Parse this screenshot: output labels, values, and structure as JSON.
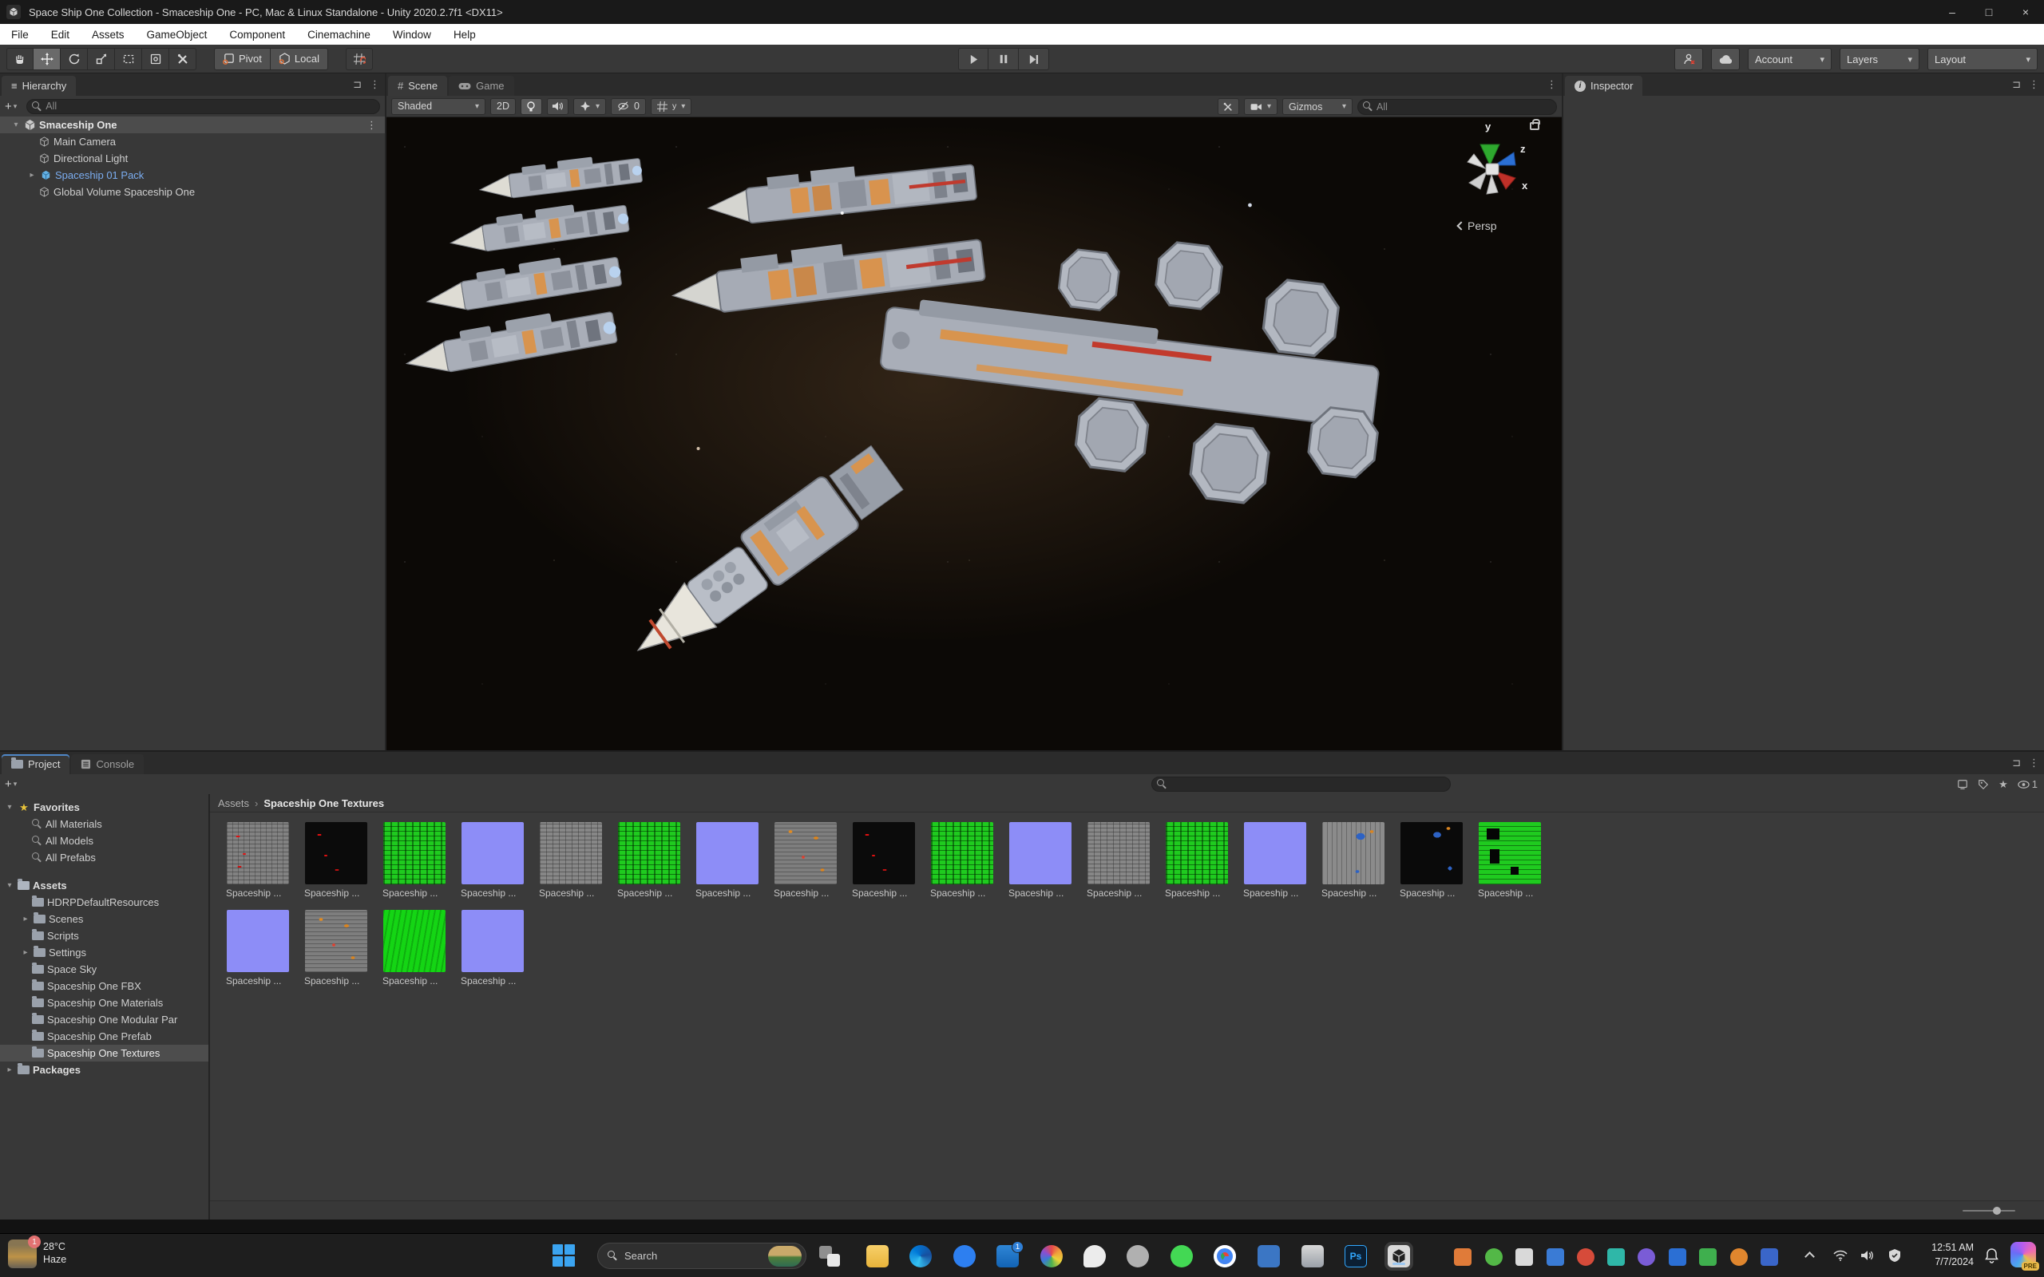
{
  "window": {
    "title": "Space Ship One Collection - Smaceship One - PC, Mac & Linux Standalone - Unity 2020.2.7f1 <DX11>",
    "controls": {
      "minimize": "–",
      "maximize": "□",
      "close": "×"
    }
  },
  "menu": {
    "items": [
      "File",
      "Edit",
      "Assets",
      "GameObject",
      "Component",
      "Cinemachine",
      "Window",
      "Help"
    ]
  },
  "toolbar": {
    "pivot": "Pivot",
    "local": "Local",
    "account": "Account",
    "layers": "Layers",
    "layout": "Layout"
  },
  "icons": {
    "more": "⋮",
    "lock": "⊐",
    "plus": "+",
    "dropdown": "▾",
    "fold_open": "▾",
    "fold_closed": "▸",
    "crumb_sep": "›",
    "star": "★",
    "info": "i",
    "hash": "#",
    "menu_lines": "≡"
  },
  "hierarchy": {
    "tab": "Hierarchy",
    "search_placeholder": "All",
    "scene_row": {
      "name": "Smaceship One"
    },
    "items": [
      {
        "label": "Main Camera"
      },
      {
        "label": "Directional Light"
      },
      {
        "label": "Spaceship 01 Pack"
      },
      {
        "label": "Global Volume Spaceship One"
      }
    ]
  },
  "scene": {
    "tab_scene": "Scene",
    "tab_game": "Game",
    "shading": "Shaded",
    "mode_2d": "2D",
    "hidden_count": "0",
    "grid_axis": "y",
    "gizmos": "Gizmos",
    "search_placeholder": "All",
    "axis_labels": {
      "x": "x",
      "y": "y",
      "z": "z"
    },
    "projection": "Persp"
  },
  "inspector": {
    "tab": "Inspector"
  },
  "project": {
    "tab_project": "Project",
    "tab_console": "Console",
    "eye_count": "1",
    "breadcrumb": {
      "root": "Assets",
      "current": "Spaceship One Textures"
    },
    "favorites": {
      "label": "Favorites",
      "items": [
        "All Materials",
        "All Models",
        "All Prefabs"
      ]
    },
    "assets": {
      "label": "Assets",
      "folders": [
        {
          "label": "HDRPDefaultResources"
        },
        {
          "label": "Scenes"
        },
        {
          "label": "Scripts"
        },
        {
          "label": "Settings"
        },
        {
          "label": "Space Sky"
        },
        {
          "label": "Spaceship One FBX"
        },
        {
          "label": "Spaceship One Materials"
        },
        {
          "label": "Spaceship One Modular Par"
        },
        {
          "label": "Spaceship One Prefab"
        },
        {
          "label": "Spaceship One Textures"
        }
      ]
    },
    "packages_label": "Packages",
    "textures": [
      {
        "label": "Spaceship ...",
        "type": "gray-red"
      },
      {
        "label": "Spaceship ...",
        "type": "black-red"
      },
      {
        "label": "Spaceship ...",
        "type": "green"
      },
      {
        "label": "Spaceship ...",
        "type": "normal"
      },
      {
        "label": "Spaceship ...",
        "type": "gray"
      },
      {
        "label": "Spaceship ...",
        "type": "green"
      },
      {
        "label": "Spaceship ...",
        "type": "normal"
      },
      {
        "label": "Spaceship ...",
        "type": "gray-orange"
      },
      {
        "label": "Spaceship ...",
        "type": "black-red"
      },
      {
        "label": "Spaceship ...",
        "type": "green"
      },
      {
        "label": "Spaceship ...",
        "type": "normal"
      },
      {
        "label": "Spaceship ...",
        "type": "gray"
      },
      {
        "label": "Spaceship ...",
        "type": "green"
      },
      {
        "label": "Spaceship ...",
        "type": "normal"
      },
      {
        "label": "Spaceship ...",
        "type": "gray-blue"
      },
      {
        "label": "Spaceship ...",
        "type": "black-blue"
      },
      {
        "label": "Spaceship ...",
        "type": "green-black"
      },
      {
        "label": "Spaceship ...",
        "type": "normal"
      },
      {
        "label": "Spaceship ...",
        "type": "gray-orange"
      },
      {
        "label": "Spaceship ...",
        "type": "green2"
      },
      {
        "label": "Spaceship ...",
        "type": "normal"
      }
    ]
  },
  "taskbar": {
    "weather": {
      "temp": "28°C",
      "condition": "Haze",
      "badge": "1"
    },
    "search": {
      "placeholder": "Search"
    },
    "mail_badge": "1",
    "photoshop_label": "Ps",
    "clock": {
      "time": "12:51 AM",
      "date": "7/7/2024"
    },
    "copilot_badge": "PRE"
  }
}
